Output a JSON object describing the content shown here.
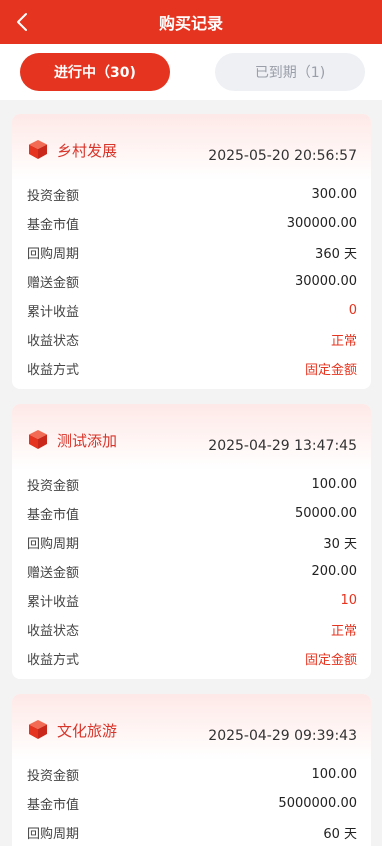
{
  "header": {
    "title": "购买记录"
  },
  "tabs": [
    {
      "label": "进行中（30)"
    },
    {
      "label": "已到期（1)"
    }
  ],
  "colors": {
    "accent": "#e5341f"
  },
  "labels": {
    "invest": "投资金额",
    "fund_value": "基金市值",
    "cycle": "回购周期",
    "bonus": "赠送金额",
    "earnings": "累计收益",
    "status": "收益状态",
    "method": "收益方式"
  },
  "records": [
    {
      "name": "乡村发展",
      "time": "2025-05-20 20:56:57",
      "invest": "300.00",
      "fund_value": "300000.00",
      "cycle": "360 天",
      "bonus": "30000.00",
      "earnings": "0",
      "status": "正常",
      "method": "固定金额"
    },
    {
      "name": "测试添加",
      "time": "2025-04-29 13:47:45",
      "invest": "100.00",
      "fund_value": "50000.00",
      "cycle": "30 天",
      "bonus": "200.00",
      "earnings": "10",
      "status": "正常",
      "method": "固定金额"
    },
    {
      "name": "文化旅游",
      "time": "2025-04-29 09:39:43",
      "invest": "100.00",
      "fund_value": "5000000.00",
      "cycle": "60 天"
    }
  ]
}
